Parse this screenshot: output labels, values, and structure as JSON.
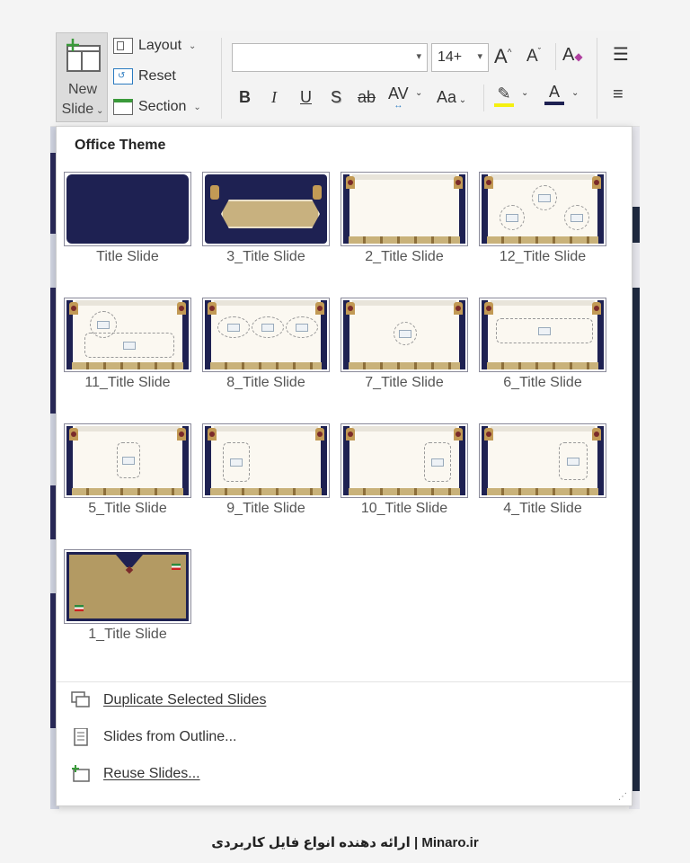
{
  "ribbon": {
    "new_slide": {
      "line1": "New",
      "line2": "Slide"
    },
    "layout_label": "Layout",
    "reset_label": "Reset",
    "section_label": "Section",
    "font_name_value": "",
    "font_size_value": "14+",
    "increase_font": "A",
    "decrease_font": "A",
    "bold": "B",
    "italic": "I",
    "underline": "U",
    "shadow": "S",
    "strikethrough": "ab",
    "char_spacing": "AV",
    "change_case": "Aa",
    "font_color_glyph": "A",
    "highlight_color": "#f5f010",
    "font_color": "#1e2152"
  },
  "panel": {
    "title": "Office Theme",
    "layouts": [
      {
        "label": "Title Slide"
      },
      {
        "label": "3_Title Slide"
      },
      {
        "label": "2_Title Slide"
      },
      {
        "label": "12_Title Slide"
      },
      {
        "label": "11_Title Slide"
      },
      {
        "label": "8_Title Slide"
      },
      {
        "label": "7_Title Slide"
      },
      {
        "label": "6_Title Slide"
      },
      {
        "label": "5_Title Slide"
      },
      {
        "label": "9_Title Slide"
      },
      {
        "label": "10_Title Slide"
      },
      {
        "label": "4_Title Slide"
      },
      {
        "label": "1_Title Slide"
      }
    ],
    "menu": {
      "duplicate": "Duplicate Selected Slides",
      "outline": "Slides from Outline...",
      "reuse": "Reuse Slides..."
    }
  },
  "footer": {
    "brand": "Minaro.ir",
    "sep": " | ",
    "tagline": "ارائه دهنده انواع فایل کاربردی"
  },
  "colors": {
    "navy": "#1e2152",
    "gold": "#b39a63",
    "paper": "#fbf8f1"
  }
}
